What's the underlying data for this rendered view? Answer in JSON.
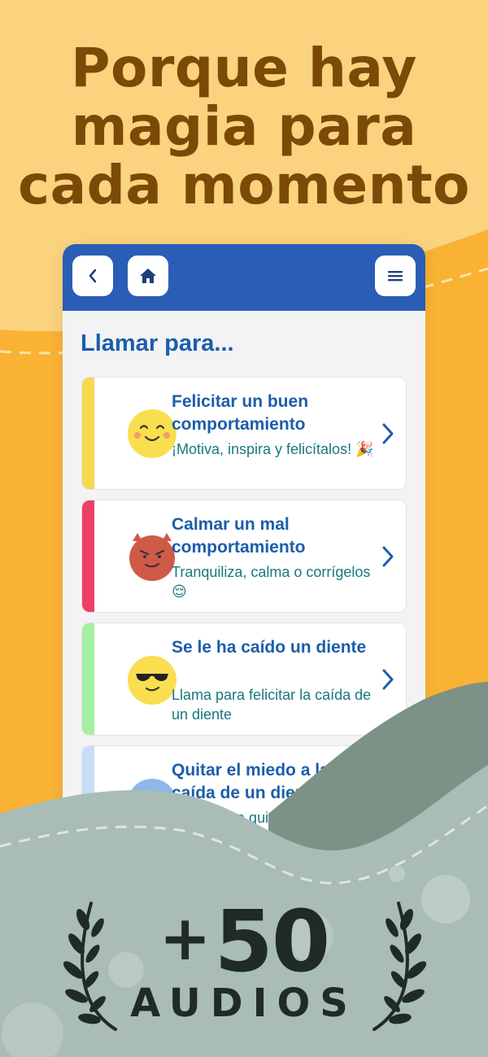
{
  "headline": {
    "line1": "Porque hay",
    "line2": "magia para",
    "line3": "cada momento"
  },
  "app": {
    "back_icon": "chevron-left-icon",
    "home_icon": "home-icon",
    "menu_icon": "hamburger-menu-icon",
    "section_title": "Llamar para...",
    "cards": [
      {
        "title": "Felicitar un buen comportamiento",
        "desc": "¡Motiva, inspira y felicítalos! 🎉",
        "accent": "#f8d84e",
        "face": "happy-face-icon"
      },
      {
        "title": "Calmar un mal comportamiento",
        "desc": "Tranquiliza, calma o corrígelos 😌",
        "accent": "#ef3f65",
        "face": "devil-face-icon"
      },
      {
        "title": "Se le ha caído un diente",
        "desc": "Llama para felicitar la caída de un diente",
        "accent": "#a4f0a0",
        "face": "sunglasses-face-icon"
      },
      {
        "title": "Quitar el miedo a la caída de un diente",
        "desc": "Llama para quitar el temor a la caída de un diente",
        "accent": "#c8def6",
        "face": "worried-face-icon"
      }
    ]
  },
  "badge": {
    "plus": "+",
    "number": "50",
    "label": "AUDIOS"
  },
  "colors": {
    "headline": "#7a4a06",
    "appbar": "#2a5db5",
    "title_blue": "#1b5eab",
    "desc_teal": "#17787e",
    "bg_light": "#fbd27e",
    "bg_orange": "#f9b234",
    "wave_sage": "#a9bcb5",
    "wave_dark": "#7c9286"
  }
}
